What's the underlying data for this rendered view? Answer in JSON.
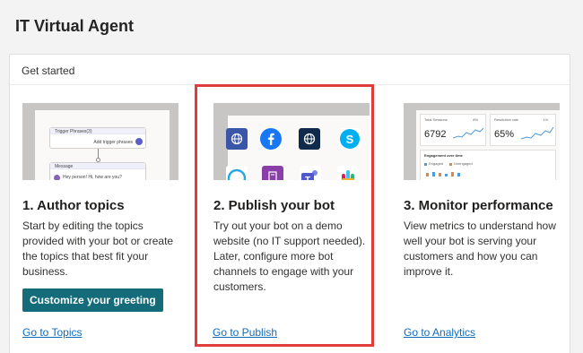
{
  "app": {
    "title": "IT Virtual Agent"
  },
  "card": {
    "header": "Get started"
  },
  "columns": [
    {
      "title": "1. Author topics",
      "description": "Start by editing the topics provided with your bot or create the topics that best fit your business.",
      "button_label": "Customize your greeting",
      "link": "Go to Topics",
      "thumbnail": {
        "trigger_label": "Trigger Phrases(3)",
        "add_label": "Add trigger phrases",
        "message_label": "Message",
        "message_text": "Hey person! Hi, how are you?"
      }
    },
    {
      "title": "2. Publish your bot",
      "description": "Try out your bot on a demo website (no IT support needed). Later, configure more bot channels to engage with your customers.",
      "link": "Go to Publish",
      "thumbnail": {
        "icons": [
          "globe-icon",
          "facebook-icon",
          "web-icon",
          "skype-icon",
          "chat-icon",
          "note-icon",
          "teams-icon",
          "slack-icon"
        ]
      }
    },
    {
      "title": "3. Monitor performance",
      "description": "View metrics to understand how well your bot is serving your customers and how you can improve it.",
      "link": "Go to Analytics",
      "thumbnail": {
        "metric1_label": "Total Sessions",
        "metric1_value": "6792",
        "metric1_badge": "8%",
        "metric2_label": "Resolution rate",
        "metric2_value": "65%",
        "metric2_badge": "1%",
        "chart_label": "Engagement over time",
        "legend1": "Engaged",
        "legend2": "Unengaged"
      }
    }
  ],
  "colors": {
    "accent": "#146c7a",
    "link": "#0f6cbd",
    "highlight": "#e03c3c"
  }
}
